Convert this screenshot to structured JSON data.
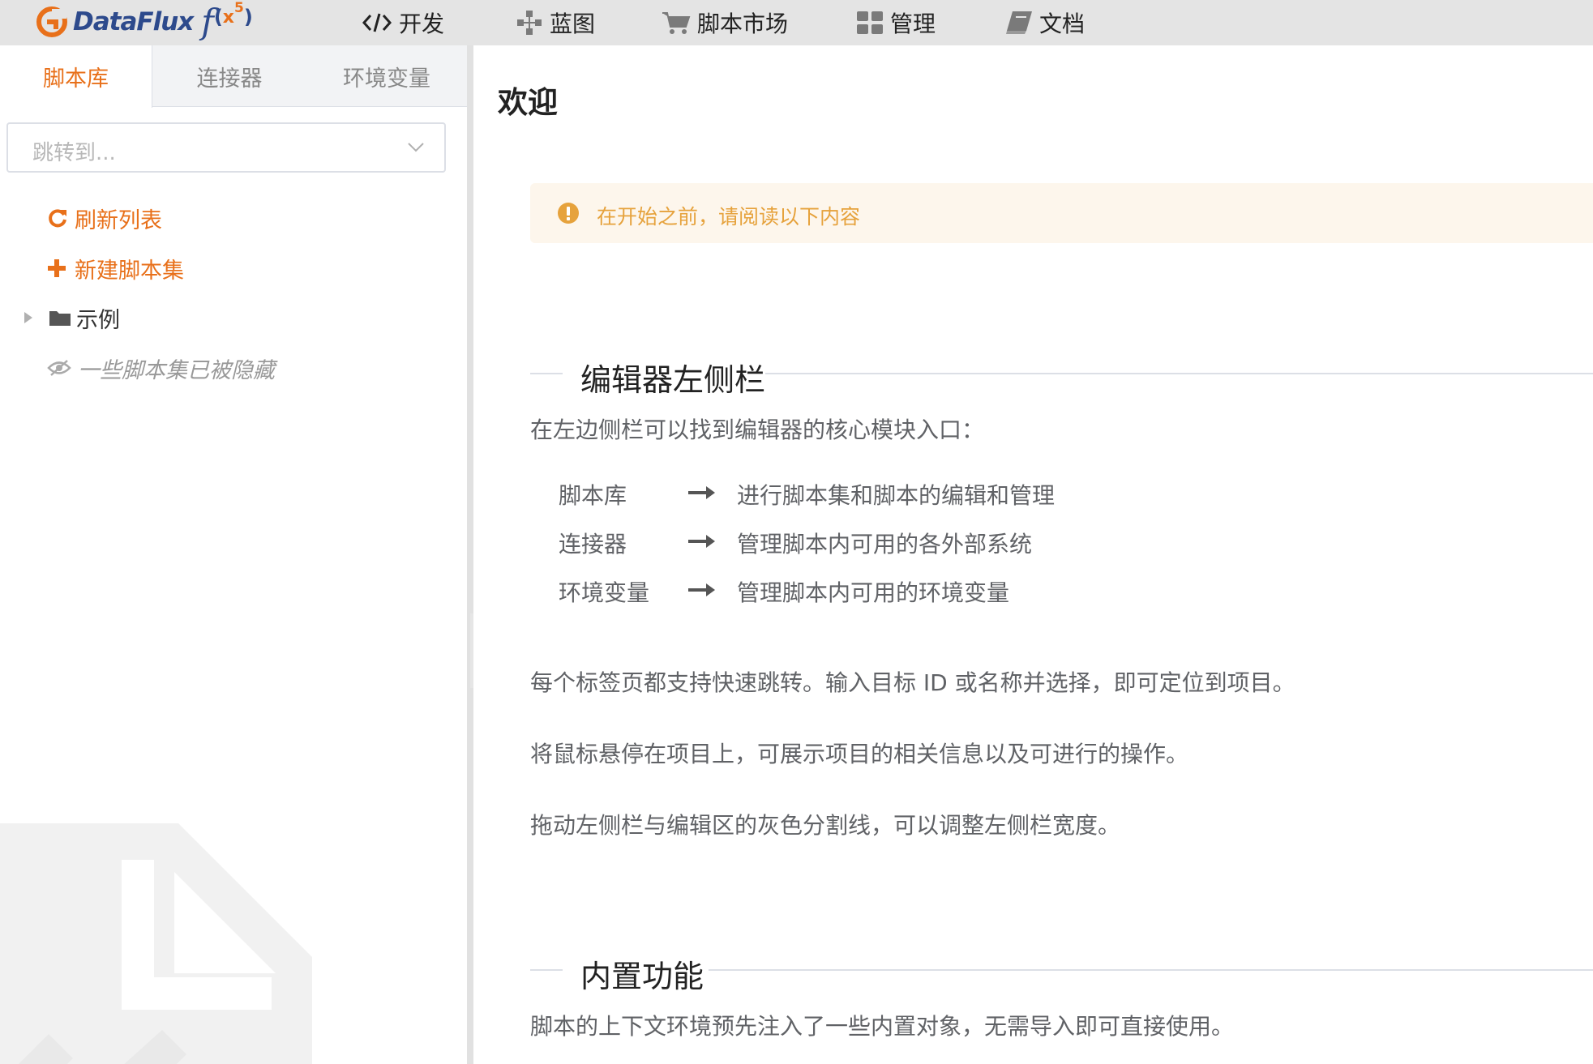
{
  "brand": {
    "name": "DataFlux",
    "fx": "f",
    "paren_open": "(",
    "x": "x",
    "sup": "5",
    "paren_close": ")"
  },
  "nav": {
    "items": [
      {
        "label": "开发",
        "icon": "code-icon"
      },
      {
        "label": "蓝图",
        "icon": "blueprint-icon"
      },
      {
        "label": "脚本市场",
        "icon": "cart-icon"
      },
      {
        "label": "管理",
        "icon": "grid-icon"
      },
      {
        "label": "文档",
        "icon": "book-icon"
      }
    ]
  },
  "sidebar": {
    "tabs": [
      {
        "label": "脚本库",
        "active": true
      },
      {
        "label": "连接器",
        "active": false
      },
      {
        "label": "环境变量",
        "active": false
      }
    ],
    "jump_placeholder": "跳转到...",
    "refresh_label": "刷新列表",
    "new_label": "新建脚本集",
    "folder_label": "示例",
    "hidden_label": "一些脚本集已被隐藏"
  },
  "main": {
    "title": "欢迎",
    "alert": "在开始之前，请阅读以下内容",
    "section1": {
      "heading": "编辑器左侧栏",
      "intro": "在左边侧栏可以找到编辑器的核心模块入口：",
      "modules": [
        {
          "name": "脚本库",
          "desc": "进行脚本集和脚本的编辑和管理"
        },
        {
          "name": "连接器",
          "desc": "管理脚本内可用的各外部系统"
        },
        {
          "name": "环境变量",
          "desc": "管理脚本内可用的环境变量"
        }
      ],
      "p1": "每个标签页都支持快速跳转。输入目标 ID 或名称并选择，即可定位到项目。",
      "p2": "将鼠标悬停在项目上，可展示项目的相关信息以及可进行的操作。",
      "p3": "拖动左侧栏与编辑区的灰色分割线，可以调整左侧栏宽度。"
    },
    "section2": {
      "heading": "内置功能",
      "p1": "脚本的上下文环境预先注入了一些内置对象，无需导入即可直接使用。"
    }
  },
  "colors": {
    "accent": "#e8701a",
    "brand_blue": "#2d4a8c",
    "alert_bg": "#fdf6ec",
    "alert_text": "#e6a23c",
    "body_text": "#606266"
  }
}
